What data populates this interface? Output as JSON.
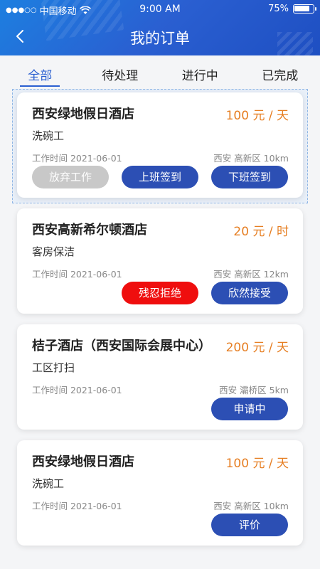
{
  "status_bar": {
    "carrier": "中国移动",
    "signal": "●●●○○",
    "time": "9:00 AM",
    "battery": "75%"
  },
  "nav": {
    "title": "我的订单"
  },
  "tabs": [
    {
      "label": "全部",
      "active": true
    },
    {
      "label": "待处理",
      "active": false
    },
    {
      "label": "进行中",
      "active": false
    },
    {
      "label": "已完成",
      "active": false
    }
  ],
  "orders": [
    {
      "hotel": "西安绿地假日酒店",
      "price": "100 元 / 天",
      "job": "洗碗工",
      "work_date": "工作时间 2021-06-01",
      "location": "西安 高新区 10km",
      "buttons": [
        "放弃工作",
        "上班签到",
        "下班签到"
      ]
    },
    {
      "hotel": "西安高新希尔顿酒店",
      "price": "20 元 / 时",
      "job": "客房保洁",
      "work_date": "工作时间 2021-06-01",
      "location": "西安 高新区 12km",
      "buttons": [
        "残忍拒绝",
        "欣然接受"
      ]
    },
    {
      "hotel": "桔子酒店（西安国际会展中心）",
      "price": "200 元 / 天",
      "job": "工区打扫",
      "work_date": "工作时间 2021-06-01",
      "location": "西安 灞桥区 5km",
      "buttons": [
        "申请中"
      ]
    },
    {
      "hotel": "西安绿地假日酒店",
      "price": "100 元 / 天",
      "job": "洗碗工",
      "work_date": "工作时间 2021-06-01",
      "location": "西安 高新区 10km",
      "buttons": [
        "评价"
      ]
    }
  ],
  "colors": {
    "primary": "#2c4fb4",
    "price": "#e67e22",
    "danger": "#ef0e0e",
    "disabled": "#c8c8c8"
  }
}
